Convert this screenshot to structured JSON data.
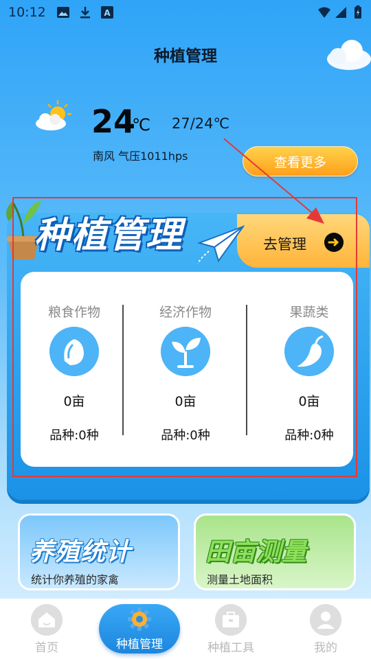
{
  "status_bar": {
    "time": "10:12",
    "icons": [
      "image-icon",
      "download-icon",
      "font-icon",
      "wifi-icon",
      "signal-icon",
      "battery-icon"
    ]
  },
  "header": {
    "title": "种植管理"
  },
  "weather": {
    "temperature": "24",
    "unit": "℃",
    "range": "27/24℃",
    "description": "南风 气压1011hps",
    "more_label": "查看更多"
  },
  "planting": {
    "banner_title": "种植管理",
    "go_manage_label": "去管理",
    "stats": [
      {
        "name": "粮食作物",
        "area": "0亩",
        "variety": "品种:0种",
        "icon": "grain-icon"
      },
      {
        "name": "经济作物",
        "area": "0亩",
        "variety": "品种:0种",
        "icon": "sprout-icon"
      },
      {
        "name": "果蔬类",
        "area": "0亩",
        "variety": "品种:0种",
        "icon": "pepper-icon"
      }
    ]
  },
  "features": [
    {
      "title": "养殖统计",
      "subtitle": "统计你养殖的家禽"
    },
    {
      "title": "田亩测量",
      "subtitle": "测量土地面积"
    }
  ],
  "nav": {
    "items": [
      {
        "label": "首页",
        "icon": "home-icon"
      },
      {
        "label": "种植管理",
        "icon": "gear-icon",
        "active": true
      },
      {
        "label": "种植工具",
        "icon": "toolbox-icon"
      },
      {
        "label": "我的",
        "icon": "user-icon"
      }
    ]
  },
  "colors": {
    "accent_blue": "#1a92e6",
    "accent_orange": "#ffb43a",
    "annotation_red": "#e53935"
  }
}
